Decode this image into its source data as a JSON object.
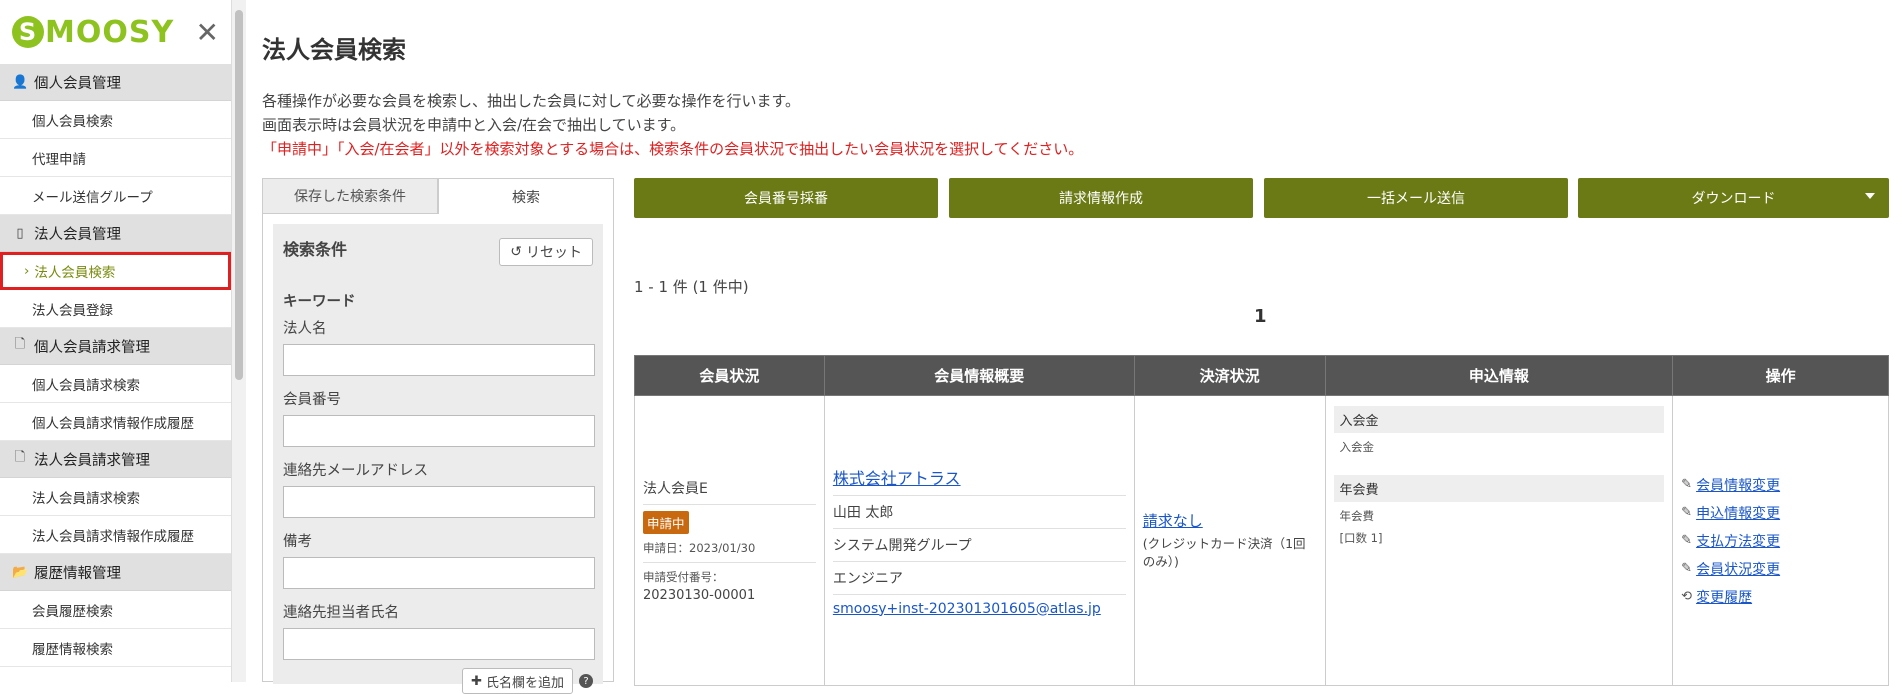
{
  "sidebar": {
    "logo": "SMOOSY",
    "sections": [
      {
        "title": "個人会員管理",
        "icon": "person-icon",
        "items": [
          "個人会員検索",
          "代理申請",
          "メール送信グループ"
        ]
      },
      {
        "title": "法人会員管理",
        "icon": "building-icon",
        "items": [
          "法人会員検索",
          "法人会員登録"
        ]
      },
      {
        "title": "個人会員請求管理",
        "icon": "document-icon",
        "items": [
          "個人会員請求検索",
          "個人会員請求情報作成履歴"
        ]
      },
      {
        "title": "法人会員請求管理",
        "icon": "document-icon",
        "items": [
          "法人会員請求検索",
          "法人会員請求情報作成履歴"
        ]
      },
      {
        "title": "履歴情報管理",
        "icon": "folder-icon",
        "items": [
          "会員履歴検索",
          "履歴情報検索"
        ]
      }
    ],
    "active_item": "法人会員検索"
  },
  "page": {
    "title": "法人会員検索",
    "desc1": "各種操作が必要な会員を検索し、抽出した会員に対して必要な操作を行います。",
    "desc2": "画面表示時は会員状況を申請中と入会/在会で抽出しています。",
    "desc3": "「申請中」「入会/在会者」以外を検索対象とする場合は、検索条件の会員状況で抽出したい会員状況を選択してください。"
  },
  "search": {
    "tab_saved": "保存した検索条件",
    "tab_search": "検索",
    "cond_title": "検索条件",
    "reset": "リセット",
    "keyword": "キーワード",
    "fields": [
      "法人名",
      "会員番号",
      "連絡先メールアドレス",
      "備考",
      "連絡先担当者氏名"
    ],
    "add_name": "氏名欄を追加"
  },
  "actions": {
    "assign_number": "会員番号採番",
    "create_invoice": "請求情報作成",
    "bulk_mail": "一括メール送信",
    "download": "ダウンロード"
  },
  "results": {
    "count": "1 - 1 件 (1 件中)",
    "page": "1",
    "headers": [
      "会員状況",
      "会員情報概要",
      "決済状況",
      "申込情報",
      "操作"
    ],
    "row": {
      "member_type": "法人会員E",
      "status_badge": "申請中",
      "apply_date": "申請日：2023/01/30",
      "receipt_label": "申請受付番号：",
      "receipt_no": "20230130-00001",
      "company": "株式会社アトラス",
      "person": "山田 太郎",
      "group": "システム開発グループ",
      "role": "エンジニア",
      "email": "smoosy+inst-202301301605@atlas.jp",
      "payment_status": "請求なし",
      "payment_note": "(クレジットカード決済（1回のみ）)",
      "entry_fee_head": "入会金",
      "entry_fee_val": "入会金",
      "annual_fee_head": "年会費",
      "annual_fee_val": "年会費",
      "annual_fee_count": "[口数 1]",
      "ops": [
        "会員情報変更",
        "申込情報変更",
        "支払方法変更",
        "会員状況変更",
        "変更履歴"
      ]
    }
  },
  "colors": {
    "accent": "#6b7a14",
    "badge": "#c9690f",
    "alert": "#e02020",
    "brand": "#8dc21f"
  }
}
